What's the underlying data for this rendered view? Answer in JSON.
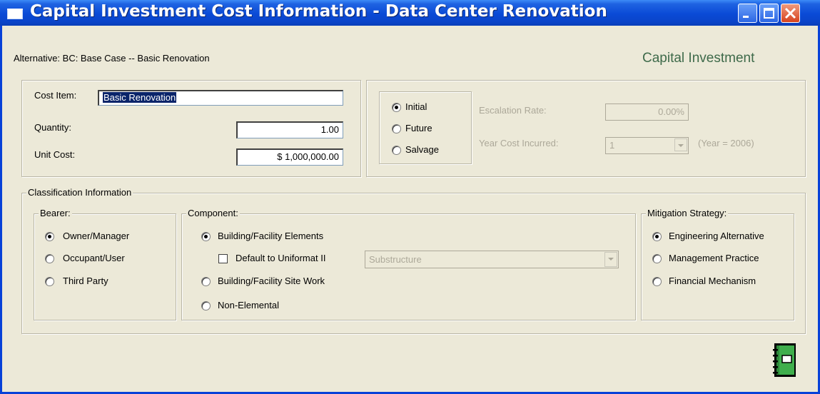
{
  "window": {
    "title": "Capital Investment Cost Information - Data Center Renovation"
  },
  "header": {
    "alternative": "Alternative:  BC: Base Case -- Basic Renovation",
    "section_title": "Capital Investment"
  },
  "cost": {
    "cost_item_label": "Cost Item:",
    "cost_item_value": "Basic Renovation",
    "quantity_label": "Quantity:",
    "quantity_value": "1.00",
    "unit_cost_label": "Unit Cost:",
    "unit_cost_value": "$ 1,000,000.00"
  },
  "timing": {
    "options": [
      "Initial",
      "Future",
      "Salvage"
    ],
    "selected": "Initial",
    "escalation_label": "Escalation Rate:",
    "escalation_value": "0.00%",
    "year_label": "Year Cost Incurred:",
    "year_value": "1",
    "year_note": "(Year = 2006)"
  },
  "classification": {
    "legend": "Classification Information",
    "bearer": {
      "legend": "Bearer:",
      "options": [
        "Owner/Manager",
        "Occupant/User",
        "Third Party"
      ],
      "selected": "Owner/Manager"
    },
    "component": {
      "legend": "Component:",
      "options": [
        "Building/Facility Elements",
        "Building/Facility Site Work",
        "Non-Elemental"
      ],
      "selected": "Building/Facility Elements",
      "uniformat_label": "Default to Uniformat II",
      "uniformat_checked": false,
      "uniformat_value": "Substructure"
    },
    "mitigation": {
      "legend": "Mitigation Strategy:",
      "options": [
        "Engineering Alternative",
        "Management Practice",
        "Financial Mechanism"
      ],
      "selected": "Engineering Alternative"
    }
  },
  "icons": {
    "window_icon": "window-icon",
    "notebook_icon": "notebook-icon"
  },
  "colors": {
    "titlebar": "#0a4ad6",
    "heading": "#3e6a4a",
    "face": "#ece9d8"
  }
}
